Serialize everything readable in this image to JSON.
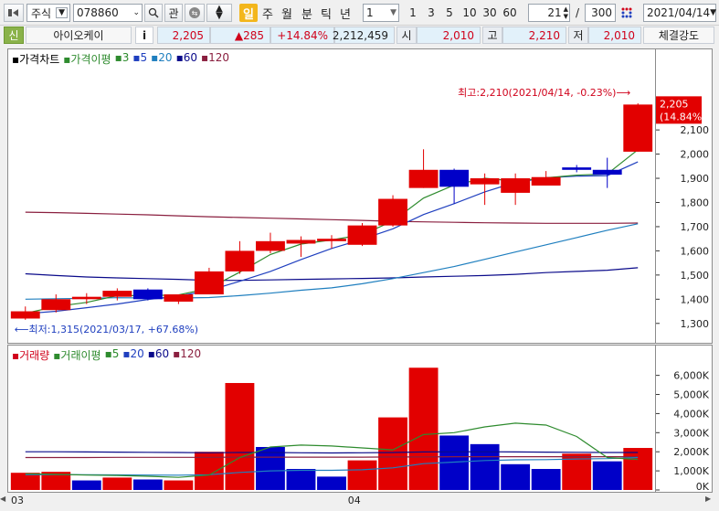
{
  "toolbar": {
    "market_select": "주식",
    "code": "078860",
    "search_label": "관",
    "periods": [
      "일",
      "주",
      "월",
      "분",
      "틱",
      "년"
    ],
    "active_period": "일",
    "unit_value": "1",
    "quick_units": [
      "1",
      "3",
      "5",
      "10",
      "30",
      "60"
    ],
    "count_value": "21",
    "count_separator": "/",
    "total_count": "300",
    "date": "2021/04/14"
  },
  "info": {
    "badge": "신",
    "name": "아이오케이",
    "i_button": "i",
    "price": "2,205",
    "change": "▲285",
    "change_pct": "+14.84%",
    "volume": "2,212,459",
    "open_label": "시",
    "open": "2,010",
    "high_label": "고",
    "high": "2,210",
    "low_label": "저",
    "low": "2,010",
    "strength_label": "체결강도"
  },
  "price_legend": [
    {
      "text": "가격차트",
      "color": "#000000"
    },
    {
      "text": "가격이평",
      "color": "#2e8b2e"
    },
    {
      "text": "3",
      "color": "#2e8b2e"
    },
    {
      "text": "5",
      "color": "#1f3fbf"
    },
    {
      "text": "20",
      "color": "#1f7fbf"
    },
    {
      "text": "60",
      "color": "#0a0a8a"
    },
    {
      "text": "120",
      "color": "#8a1f3f"
    }
  ],
  "volume_legend": [
    {
      "text": "거래량",
      "color": "#d0021b"
    },
    {
      "text": "거래이평",
      "color": "#2e8b2e"
    },
    {
      "text": "5",
      "color": "#2e8b2e"
    },
    {
      "text": "20",
      "color": "#1f3fbf"
    },
    {
      "text": "60",
      "color": "#0a0a8a"
    },
    {
      "text": "120",
      "color": "#8a1f3f"
    }
  ],
  "annotations": {
    "high": "최고:2,210(2021/04/14, -0.23%)⟶",
    "low": "⟵최저:1,315(2021/03/17, +67.68%)",
    "current_price": "2,205",
    "current_pct": "(14.84%)"
  },
  "date_labels": [
    {
      "text": "03",
      "index": 0
    },
    {
      "text": "04",
      "index": 11
    }
  ],
  "colors": {
    "up": "#e20000",
    "down": "#0000c8",
    "ma3": "#2e8b2e",
    "ma5": "#1f3fbf",
    "ma20": "#1f7fbf",
    "ma60": "#0a0a8a",
    "ma120": "#8a1f3f"
  },
  "chart_data": [
    {
      "type": "candlestick",
      "title": "가격차트",
      "ylim": [
        1250,
        2350
      ],
      "yticks": [
        1300,
        1400,
        1500,
        1600,
        1700,
        1800,
        1900,
        2000,
        2100
      ],
      "candles": [
        {
          "o": 1320,
          "h": 1370,
          "l": 1315,
          "c": 1350
        },
        {
          "o": 1355,
          "h": 1420,
          "l": 1345,
          "c": 1400
        },
        {
          "o": 1400,
          "h": 1425,
          "l": 1380,
          "c": 1410
        },
        {
          "o": 1410,
          "h": 1445,
          "l": 1395,
          "c": 1435
        },
        {
          "o": 1440,
          "h": 1445,
          "l": 1395,
          "c": 1400
        },
        {
          "o": 1390,
          "h": 1420,
          "l": 1380,
          "c": 1420
        },
        {
          "o": 1420,
          "h": 1530,
          "l": 1420,
          "c": 1515
        },
        {
          "o": 1515,
          "h": 1640,
          "l": 1505,
          "c": 1600
        },
        {
          "o": 1600,
          "h": 1675,
          "l": 1590,
          "c": 1640
        },
        {
          "o": 1630,
          "h": 1660,
          "l": 1575,
          "c": 1645
        },
        {
          "o": 1640,
          "h": 1665,
          "l": 1610,
          "c": 1650
        },
        {
          "o": 1625,
          "h": 1715,
          "l": 1620,
          "c": 1705
        },
        {
          "o": 1705,
          "h": 1830,
          "l": 1700,
          "c": 1815
        },
        {
          "o": 1860,
          "h": 2020,
          "l": 1860,
          "c": 1935
        },
        {
          "o": 1935,
          "h": 1940,
          "l": 1795,
          "c": 1865
        },
        {
          "o": 1875,
          "h": 1920,
          "l": 1790,
          "c": 1900
        },
        {
          "o": 1840,
          "h": 1920,
          "l": 1790,
          "c": 1900
        },
        {
          "o": 1870,
          "h": 1930,
          "l": 1870,
          "c": 1905
        },
        {
          "o": 1945,
          "h": 1955,
          "l": 1925,
          "c": 1935
        },
        {
          "o": 1935,
          "h": 1985,
          "l": 1860,
          "c": 1915
        },
        {
          "o": 2010,
          "h": 2210,
          "l": 2010,
          "c": 2205
        }
      ],
      "ma3": [
        1342,
        1370,
        1387,
        1415,
        1415,
        1418,
        1445,
        1512,
        1585,
        1628,
        1645,
        1667,
        1723,
        1818,
        1872,
        1900,
        1888,
        1902,
        1913,
        1918,
        2018
      ],
      "ma5": [
        1340,
        1350,
        1365,
        1380,
        1399,
        1413,
        1436,
        1474,
        1515,
        1564,
        1610,
        1648,
        1691,
        1750,
        1795,
        1844,
        1883,
        1902,
        1909,
        1911,
        1968
      ],
      "ma20": [
        1400,
        1402,
        1404,
        1406,
        1405,
        1405,
        1407,
        1415,
        1425,
        1437,
        1447,
        1464,
        1485,
        1510,
        1535,
        1565,
        1595,
        1625,
        1655,
        1685,
        1712
      ],
      "ma60": [
        1505,
        1498,
        1492,
        1488,
        1485,
        1482,
        1478,
        1478,
        1480,
        1482,
        1484,
        1486,
        1488,
        1492,
        1495,
        1498,
        1503,
        1510,
        1515,
        1520,
        1530
      ],
      "ma120": [
        1760,
        1758,
        1755,
        1752,
        1749,
        1745,
        1741,
        1738,
        1735,
        1732,
        1729,
        1726,
        1722,
        1720,
        1718,
        1716,
        1715,
        1714,
        1714,
        1714,
        1715
      ]
    },
    {
      "type": "bar",
      "title": "거래량",
      "ylim": [
        0,
        6700000
      ],
      "yticks": [
        {
          "v": 0,
          "t": "0K"
        },
        {
          "v": 1000000,
          "t": "1,000K"
        },
        {
          "v": 2000000,
          "t": "2,000K"
        },
        {
          "v": 3000000,
          "t": "3,000K"
        },
        {
          "v": 4000000,
          "t": "4,000K"
        },
        {
          "v": 5000000,
          "t": "5,000K"
        },
        {
          "v": 6000000,
          "t": "6,000K"
        }
      ],
      "values": [
        900000,
        950000,
        500000,
        650000,
        550000,
        500000,
        2000000,
        5600000,
        2250000,
        1100000,
        700000,
        1550000,
        3800000,
        6400000,
        2850000,
        2400000,
        1350000,
        1100000,
        1900000,
        1500000,
        2200000
      ],
      "up": [
        true,
        true,
        false,
        true,
        false,
        true,
        true,
        true,
        false,
        false,
        false,
        true,
        true,
        true,
        false,
        false,
        false,
        false,
        true,
        false,
        true
      ],
      "ma5": [
        850000,
        820000,
        780000,
        760000,
        720000,
        660000,
        780000,
        1700000,
        2250000,
        2350000,
        2300000,
        2200000,
        2100000,
        2900000,
        3000000,
        3300000,
        3500000,
        3400000,
        2800000,
        1700000,
        1600000
      ],
      "ma20": [
        800000,
        810000,
        800000,
        790000,
        780000,
        775000,
        800000,
        920000,
        1000000,
        1030000,
        1030000,
        1060000,
        1160000,
        1380000,
        1460000,
        1540000,
        1580000,
        1590000,
        1620000,
        1640000,
        1700000
      ],
      "ma60": [
        2000000,
        2000000,
        1990000,
        1980000,
        1970000,
        1960000,
        1950000,
        1960000,
        1960000,
        1950000,
        1940000,
        1950000,
        1960000,
        1990000,
        2000000,
        2000000,
        1990000,
        1980000,
        1970000,
        1960000,
        1960000
      ],
      "ma120": [
        1700000,
        1700000,
        1700000,
        1710000,
        1710000,
        1710000,
        1710000,
        1720000,
        1720000,
        1720000,
        1720000,
        1720000,
        1730000,
        1730000,
        1740000,
        1740000,
        1740000,
        1740000,
        1740000,
        1740000,
        1740000
      ]
    }
  ]
}
